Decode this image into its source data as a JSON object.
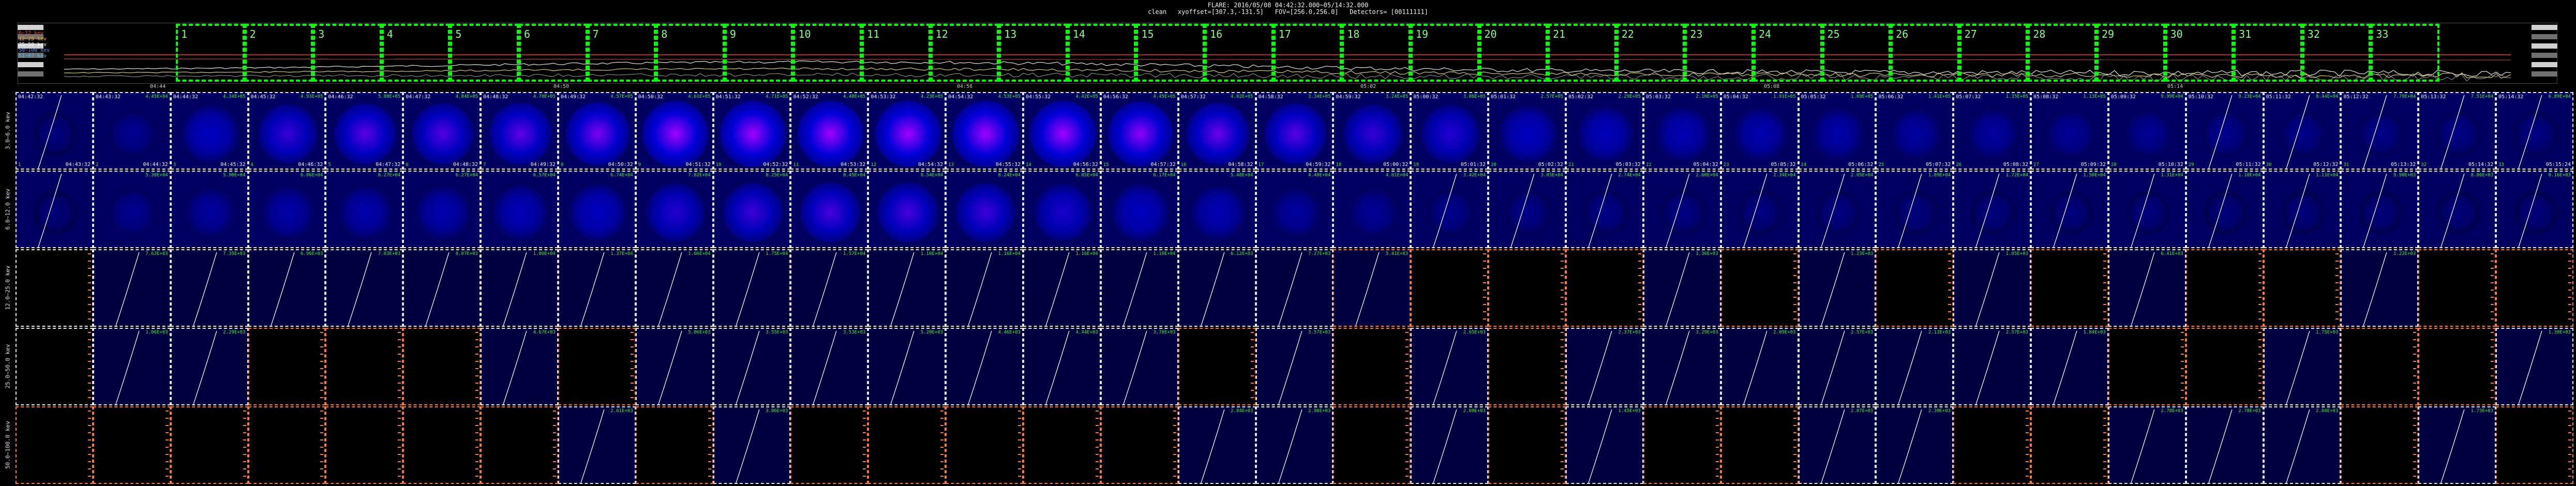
{
  "header": {
    "line1": "FLARE: 2016/05/08 04:42:32.000~05/14:32.000",
    "line2": "clean   xyoffset=[307.3,-131.5]   FOV=[256.0,256.0]   Detectors= [00111111]"
  },
  "legend": [
    {
      "label": "3~6 kev",
      "color": "#d8d8d8"
    },
    {
      "label": "6~12 kev",
      "color": "#ff4040"
    },
    {
      "label": "12~25 kev",
      "color": "#ffa500"
    },
    {
      "label": "25~50 kev",
      "color": "#ffffff"
    },
    {
      "label": "50~100 kev",
      "color": "#5a9bff"
    },
    {
      "label": "51~97 kev",
      "color": "#40c0ff"
    }
  ],
  "segments": [
    "1",
    "2",
    "3",
    "4",
    "5",
    "6",
    "7",
    "8",
    "9",
    "10",
    "11",
    "12",
    "13",
    "14",
    "15",
    "16",
    "17",
    "18",
    "19",
    "20",
    "21",
    "22",
    "23",
    "24",
    "25",
    "26",
    "27",
    "28",
    "29",
    "30",
    "31",
    "32",
    "33"
  ],
  "top_time_labels": [
    "04:44",
    "04:50",
    "04:56",
    "05:02",
    "05:08",
    "05:14"
  ],
  "rows": [
    {
      "label": "3.0~6.0 kev"
    },
    {
      "label": "6.0~12.0 kev"
    },
    {
      "label": "12.0~25.0 kev"
    },
    {
      "label": "25.0~50.0 kev"
    },
    {
      "label": "50.0~100.0 kev"
    }
  ],
  "row0_start": [
    "04:42:32",
    "04:43:32",
    "04:44:32",
    "04:45:32",
    "04:46:32",
    "04:47:32",
    "04:48:32",
    "04:49:32",
    "04:50:32",
    "04:51:32",
    "04:52:32",
    "04:53:32",
    "04:54:32",
    "04:55:32",
    "04:56:32",
    "04:57:32",
    "04:58:32",
    "04:59:32",
    "05:00:32",
    "05:01:32",
    "05:02:32",
    "05:03:32",
    "05:04:32",
    "05:05:32",
    "05:06:32",
    "05:07:32",
    "05:08:32",
    "05:09:32",
    "05:10:32",
    "05:11:32",
    "05:12:32",
    "05:13:32",
    "05:14:32"
  ],
  "row0_end": [
    "04:43:32",
    "04:44:32",
    "04:45:32",
    "04:46:32",
    "04:47:32",
    "04:48:32",
    "04:49:32",
    "04:50:32",
    "04:51:32",
    "04:52:32",
    "04:53:32",
    "04:54:32",
    "04:55:32",
    "04:56:32",
    "04:57:32",
    "04:58:32",
    "04:59:32",
    "05:00:32",
    "05:01:32",
    "05:02:32",
    "05:03:32",
    "05:04:32",
    "05:05:32",
    "05:06:32",
    "05:07:32",
    "05:08:32",
    "05:09:32",
    "05:10:32",
    "05:11:32",
    "05:12:32",
    "05:13:32",
    "05:14:32",
    "05:15:24"
  ],
  "row0_values": [
    "",
    "4.45E+04",
    "4.34E+05",
    "4.93E+05",
    "5.00E+05",
    "4.84E+05",
    "4.70E+05",
    "4.57E+05",
    "4.61E+05",
    "4.71E+05",
    "4.40E+05",
    "4.23E+05",
    "4.53E+05",
    "4.42E+05",
    "4.45E+05",
    "4.02E+05",
    "3.34E+05",
    "3.24E+05",
    "3.06E+05",
    "2.57E+05",
    "2.29E+05",
    "2.10E+05",
    "1.91E+05",
    "1.69E+05",
    "1.41E+05",
    "1.35E+05",
    "1.13E+05",
    "9.99E+04",
    "9.23E+04",
    "8.44E+04",
    "7.79E+04",
    "7.51E+04",
    "6.89E+04"
  ],
  "row0_intensity": [
    0.05,
    0.2,
    0.55,
    0.7,
    0.8,
    0.78,
    0.82,
    0.9,
    1.0,
    1.0,
    1.0,
    1.0,
    1.0,
    1.0,
    0.95,
    0.85,
    0.8,
    0.7,
    0.65,
    0.55,
    0.5,
    0.45,
    0.42,
    0.38,
    0.32,
    0.3,
    0.25,
    0.22,
    0.18,
    0.15,
    0.14,
    0.12,
    0.1
  ],
  "row1_values": [
    "",
    "5.30E+04",
    "5.90E+04",
    "6.06E+04",
    "6.27E+04",
    "6.27E+04",
    "6.57E+04",
    "6.74E+04",
    "7.02E+04",
    "8.25E+04",
    "8.45E+04",
    "8.54E+04",
    "8.24E+04",
    "6.85E+04",
    "6.17E+04",
    "5.48E+04",
    "4.40E+04",
    "4.01E+04",
    "3.42E+04",
    "3.05E+04",
    "2.74E+04",
    "2.60E+04",
    "2.34E+04",
    "2.05E+04",
    "1.89E+04",
    "1.72E+04",
    "1.50E+04",
    "1.31E+04",
    "1.18E+04",
    "1.11E+04",
    "9.90E+03",
    "8.86E+03",
    "8.16E+03"
  ],
  "row1_intensity": [
    0.02,
    0.2,
    0.3,
    0.38,
    0.4,
    0.42,
    0.48,
    0.55,
    0.65,
    0.72,
    0.75,
    0.75,
    0.72,
    0.62,
    0.55,
    0.45,
    0.3,
    0.25,
    0.18,
    0.14,
    0.12,
    0.1,
    0.09,
    0.08,
    0.07,
    0.06,
    0.05,
    0.05,
    0.04,
    0.04,
    0.03,
    0.03,
    0.03
  ],
  "row2_values": [
    "",
    "7.63E+03",
    "7.35E+03",
    "6.96E+03",
    "7.03E+03",
    "8.07E+03",
    "1.06E+04",
    "1.37E+04",
    "1.66E+04",
    "1.75E+04",
    "1.57E+04",
    "1.16E+04",
    "1.16E+04",
    "1.16E+04",
    "1.10E+04",
    "6.12E+03",
    "7.27E+03",
    "5.41E+03",
    "",
    "",
    "",
    "1.36E+03",
    "",
    "1.23E+03",
    "",
    "1.05E+03",
    "",
    "6.41E+03",
    "",
    "",
    "1.22E+03",
    "",
    ""
  ],
  "row2_border": [
    "w",
    "w",
    "w",
    "w",
    "w",
    "w",
    "w",
    "w",
    "w",
    "w",
    "w",
    "w",
    "w",
    "w",
    "w",
    "w",
    "w",
    "o",
    "o",
    "o",
    "o",
    "w",
    "o",
    "w",
    "o",
    "w",
    "o",
    "w",
    "o",
    "o",
    "w",
    "o",
    "o"
  ],
  "row3_values": [
    "",
    "1.06E+03",
    "2.29E+03",
    "",
    "",
    "",
    "4.67E+03",
    "",
    "5.06E+03",
    "3.55E+03",
    "3.53E+03",
    "5.20E+03",
    "4.46E+03",
    "4.44E+03",
    "3.78E+03",
    "",
    "3.57E+03",
    "",
    "2.65E+03",
    "",
    "2.37E+03",
    "3.29E+03",
    "2.09E+03",
    "2.57E+03",
    "2.13E+03",
    "2.57E+03",
    "1.84E+03",
    "",
    "",
    "1.75E+03",
    "",
    "",
    "1.30E+03"
  ],
  "row3_border": [
    "w",
    "w",
    "w",
    "o",
    "o",
    "o",
    "w",
    "o",
    "w",
    "w",
    "w",
    "w",
    "w",
    "w",
    "w",
    "o",
    "w",
    "o",
    "w",
    "o",
    "w",
    "w",
    "w",
    "w",
    "w",
    "w",
    "w",
    "o",
    "o",
    "w",
    "o",
    "o",
    "w"
  ],
  "row4_values": [
    "",
    "",
    "",
    "",
    "",
    "",
    "",
    "2.61E+03",
    "",
    "3.06E+03",
    "",
    "",
    "",
    "",
    "",
    "2.84E+03",
    "2.96E+03",
    "",
    "2.00E+03",
    "",
    "1.45E+03",
    "",
    "",
    "2.07E+03",
    "2.30E+03",
    "",
    "",
    "2.78E+03",
    "2.78E+03",
    "2.04E+03",
    "",
    "1.73E+03",
    ""
  ],
  "row4_border": [
    "o",
    "o",
    "o",
    "o",
    "o",
    "o",
    "o",
    "w",
    "o",
    "w",
    "o",
    "o",
    "o",
    "o",
    "o",
    "w",
    "w",
    "o",
    "w",
    "o",
    "w",
    "o",
    "o",
    "w",
    "w",
    "o",
    "o",
    "w",
    "w",
    "w",
    "o",
    "w",
    "o"
  ]
}
